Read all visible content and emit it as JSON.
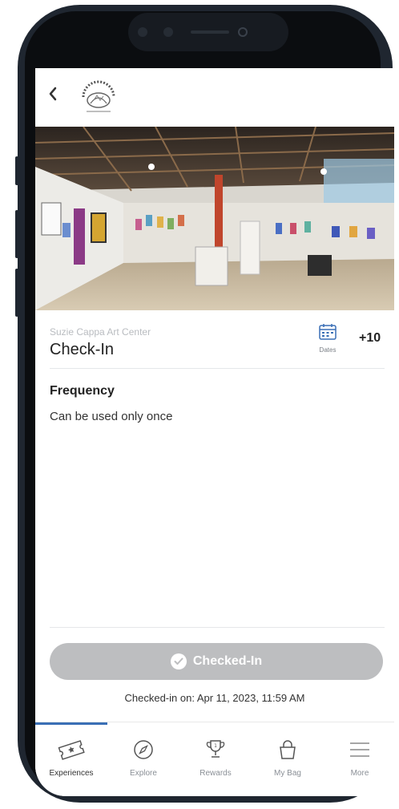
{
  "header": {
    "back_icon": "chevron-left-icon",
    "logo": "south-dakota-logo"
  },
  "experience": {
    "venue": "Suzie Cappa Art Center",
    "title": "Check-In",
    "dates_label": "Dates",
    "points": "+10"
  },
  "frequency": {
    "heading": "Frequency",
    "text": "Can be used only once"
  },
  "action": {
    "button_label": "Checked-In",
    "checked_on": "Checked-in on: Apr 11, 2023, 11:59 AM"
  },
  "tabs": [
    {
      "label": "Experiences",
      "icon": "ticket-icon",
      "active": true
    },
    {
      "label": "Explore",
      "icon": "compass-icon",
      "active": false
    },
    {
      "label": "Rewards",
      "icon": "trophy-icon",
      "active": false
    },
    {
      "label": "My Bag",
      "icon": "bag-icon",
      "active": false
    },
    {
      "label": "More",
      "icon": "menu-icon",
      "active": false
    }
  ],
  "colors": {
    "accent": "#3a6fb5",
    "button_disabled": "#bdbec0"
  }
}
